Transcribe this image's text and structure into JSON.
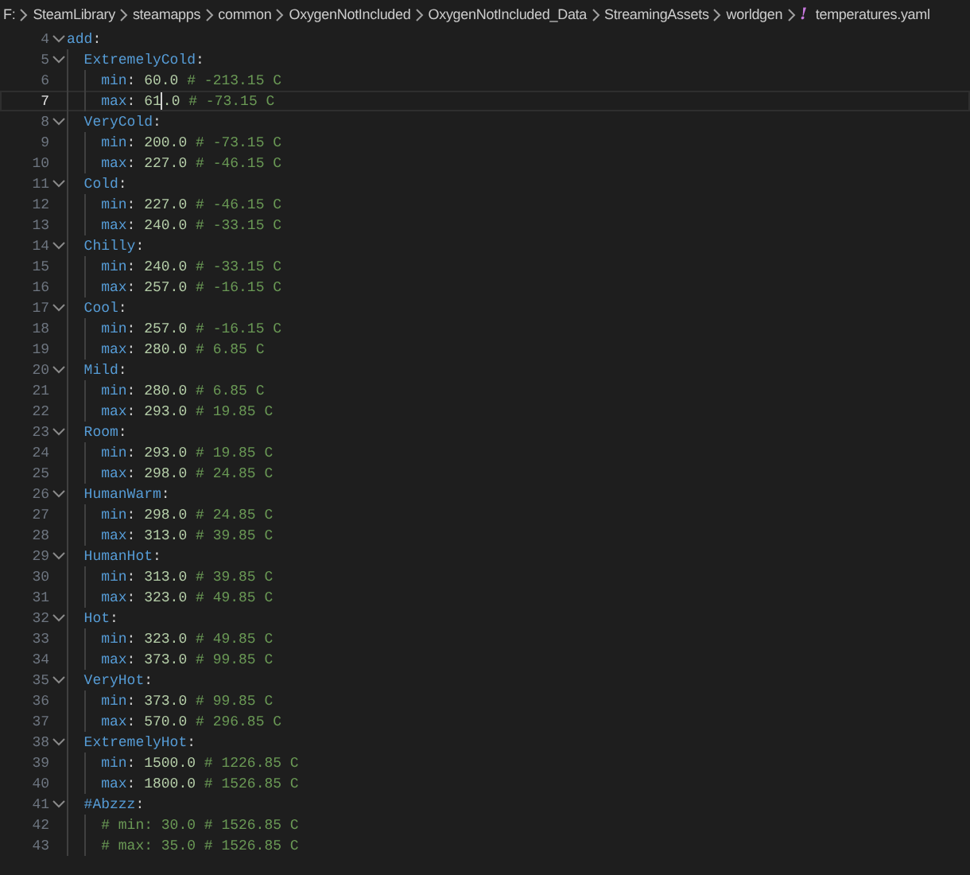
{
  "breadcrumb": [
    {
      "kind": "folder",
      "text": "F:"
    },
    {
      "kind": "folder",
      "text": "SteamLibrary"
    },
    {
      "kind": "folder",
      "text": "steamapps"
    },
    {
      "kind": "folder",
      "text": "common"
    },
    {
      "kind": "folder",
      "text": "OxygenNotIncluded"
    },
    {
      "kind": "folder",
      "text": "OxygenNotIncluded_Data"
    },
    {
      "kind": "folder",
      "text": "StreamingAssets"
    },
    {
      "kind": "folder",
      "text": "worldgen"
    },
    {
      "kind": "yaml",
      "icon": "!",
      "text": "temperatures.yaml"
    }
  ],
  "lines": [
    {
      "number": "4",
      "active": false,
      "tokens": [
        {
          "kind": "key",
          "text": "add"
        },
        {
          "kind": "punct",
          "text": ":"
        }
      ],
      "children": [
        {
          "number": "5",
          "active": false,
          "tokens": [
            {
              "kind": "key",
              "text": "ExtremelyCold"
            },
            {
              "kind": "punct",
              "text": ":"
            }
          ],
          "children": [
            {
              "number": "6",
              "active": false,
              "tokens": [
                {
                  "kind": "key",
                  "text": "min"
                },
                {
                  "kind": "punct",
                  "text": ": "
                },
                {
                  "kind": "number",
                  "text": "60.0"
                },
                {
                  "kind": "comment",
                  "text": " # -213.15 C"
                }
              ]
            },
            {
              "number": "7",
              "active": true,
              "tokens": [
                {
                  "kind": "key",
                  "text": "max"
                },
                {
                  "kind": "punct",
                  "text": ": "
                },
                {
                  "kind": "number",
                  "text": "61"
                },
                {
                  "kind": "caret"
                },
                {
                  "kind": "number",
                  "text": ".0"
                },
                {
                  "kind": "comment",
                  "text": " # -73.15 C"
                }
              ]
            }
          ]
        },
        {
          "number": "8",
          "active": false,
          "tokens": [
            {
              "kind": "key",
              "text": "VeryCold"
            },
            {
              "kind": "punct",
              "text": ":"
            }
          ],
          "children": [
            {
              "number": "9",
              "active": false,
              "tokens": [
                {
                  "kind": "key",
                  "text": "min"
                },
                {
                  "kind": "punct",
                  "text": ": "
                },
                {
                  "kind": "number",
                  "text": "200.0"
                },
                {
                  "kind": "comment",
                  "text": " # -73.15 C"
                }
              ]
            },
            {
              "number": "10",
              "active": false,
              "tokens": [
                {
                  "kind": "key",
                  "text": "max"
                },
                {
                  "kind": "punct",
                  "text": ": "
                },
                {
                  "kind": "number",
                  "text": "227.0"
                },
                {
                  "kind": "comment",
                  "text": " # -46.15 C"
                }
              ]
            }
          ]
        },
        {
          "number": "11",
          "active": false,
          "tokens": [
            {
              "kind": "key",
              "text": "Cold"
            },
            {
              "kind": "punct",
              "text": ":"
            }
          ],
          "children": [
            {
              "number": "12",
              "active": false,
              "tokens": [
                {
                  "kind": "key",
                  "text": "min"
                },
                {
                  "kind": "punct",
                  "text": ": "
                },
                {
                  "kind": "number",
                  "text": "227.0"
                },
                {
                  "kind": "comment",
                  "text": " # -46.15 C"
                }
              ]
            },
            {
              "number": "13",
              "active": false,
              "tokens": [
                {
                  "kind": "key",
                  "text": "max"
                },
                {
                  "kind": "punct",
                  "text": ": "
                },
                {
                  "kind": "number",
                  "text": "240.0"
                },
                {
                  "kind": "comment",
                  "text": " # -33.15 C"
                }
              ]
            }
          ]
        },
        {
          "number": "14",
          "active": false,
          "tokens": [
            {
              "kind": "key",
              "text": "Chilly"
            },
            {
              "kind": "punct",
              "text": ":"
            }
          ],
          "children": [
            {
              "number": "15",
              "active": false,
              "tokens": [
                {
                  "kind": "key",
                  "text": "min"
                },
                {
                  "kind": "punct",
                  "text": ": "
                },
                {
                  "kind": "number",
                  "text": "240.0"
                },
                {
                  "kind": "comment",
                  "text": " # -33.15 C"
                }
              ]
            },
            {
              "number": "16",
              "active": false,
              "tokens": [
                {
                  "kind": "key",
                  "text": "max"
                },
                {
                  "kind": "punct",
                  "text": ": "
                },
                {
                  "kind": "number",
                  "text": "257.0"
                },
                {
                  "kind": "comment",
                  "text": " # -16.15 C"
                }
              ]
            }
          ]
        },
        {
          "number": "17",
          "active": false,
          "tokens": [
            {
              "kind": "key",
              "text": "Cool"
            },
            {
              "kind": "punct",
              "text": ":"
            }
          ],
          "children": [
            {
              "number": "18",
              "active": false,
              "tokens": [
                {
                  "kind": "key",
                  "text": "min"
                },
                {
                  "kind": "punct",
                  "text": ": "
                },
                {
                  "kind": "number",
                  "text": "257.0"
                },
                {
                  "kind": "comment",
                  "text": " # -16.15 C"
                }
              ]
            },
            {
              "number": "19",
              "active": false,
              "tokens": [
                {
                  "kind": "key",
                  "text": "max"
                },
                {
                  "kind": "punct",
                  "text": ": "
                },
                {
                  "kind": "number",
                  "text": "280.0"
                },
                {
                  "kind": "comment",
                  "text": " # 6.85 C"
                }
              ]
            }
          ]
        },
        {
          "number": "20",
          "active": false,
          "tokens": [
            {
              "kind": "key",
              "text": "Mild"
            },
            {
              "kind": "punct",
              "text": ":"
            }
          ],
          "children": [
            {
              "number": "21",
              "active": false,
              "tokens": [
                {
                  "kind": "key",
                  "text": "min"
                },
                {
                  "kind": "punct",
                  "text": ": "
                },
                {
                  "kind": "number",
                  "text": "280.0"
                },
                {
                  "kind": "comment",
                  "text": " # 6.85 C"
                }
              ]
            },
            {
              "number": "22",
              "active": false,
              "tokens": [
                {
                  "kind": "key",
                  "text": "max"
                },
                {
                  "kind": "punct",
                  "text": ": "
                },
                {
                  "kind": "number",
                  "text": "293.0"
                },
                {
                  "kind": "comment",
                  "text": " # 19.85 C"
                }
              ]
            }
          ]
        },
        {
          "number": "23",
          "active": false,
          "tokens": [
            {
              "kind": "key",
              "text": "Room"
            },
            {
              "kind": "punct",
              "text": ":"
            }
          ],
          "children": [
            {
              "number": "24",
              "active": false,
              "tokens": [
                {
                  "kind": "key",
                  "text": "min"
                },
                {
                  "kind": "punct",
                  "text": ": "
                },
                {
                  "kind": "number",
                  "text": "293.0"
                },
                {
                  "kind": "comment",
                  "text": " # 19.85 C"
                }
              ]
            },
            {
              "number": "25",
              "active": false,
              "tokens": [
                {
                  "kind": "key",
                  "text": "max"
                },
                {
                  "kind": "punct",
                  "text": ": "
                },
                {
                  "kind": "number",
                  "text": "298.0"
                },
                {
                  "kind": "comment",
                  "text": " # 24.85 C"
                }
              ]
            }
          ]
        },
        {
          "number": "26",
          "active": false,
          "tokens": [
            {
              "kind": "key",
              "text": "HumanWarm"
            },
            {
              "kind": "punct",
              "text": ":"
            }
          ],
          "children": [
            {
              "number": "27",
              "active": false,
              "tokens": [
                {
                  "kind": "key",
                  "text": "min"
                },
                {
                  "kind": "punct",
                  "text": ": "
                },
                {
                  "kind": "number",
                  "text": "298.0"
                },
                {
                  "kind": "comment",
                  "text": " # 24.85 C"
                }
              ]
            },
            {
              "number": "28",
              "active": false,
              "tokens": [
                {
                  "kind": "key",
                  "text": "max"
                },
                {
                  "kind": "punct",
                  "text": ": "
                },
                {
                  "kind": "number",
                  "text": "313.0"
                },
                {
                  "kind": "comment",
                  "text": " # 39.85 C"
                }
              ]
            }
          ]
        },
        {
          "number": "29",
          "active": false,
          "tokens": [
            {
              "kind": "key",
              "text": "HumanHot"
            },
            {
              "kind": "punct",
              "text": ":"
            }
          ],
          "children": [
            {
              "number": "30",
              "active": false,
              "tokens": [
                {
                  "kind": "key",
                  "text": "min"
                },
                {
                  "kind": "punct",
                  "text": ": "
                },
                {
                  "kind": "number",
                  "text": "313.0"
                },
                {
                  "kind": "comment",
                  "text": " # 39.85 C"
                }
              ]
            },
            {
              "number": "31",
              "active": false,
              "tokens": [
                {
                  "kind": "key",
                  "text": "max"
                },
                {
                  "kind": "punct",
                  "text": ": "
                },
                {
                  "kind": "number",
                  "text": "323.0"
                },
                {
                  "kind": "comment",
                  "text": " # 49.85 C"
                }
              ]
            }
          ]
        },
        {
          "number": "32",
          "active": false,
          "tokens": [
            {
              "kind": "key",
              "text": "Hot"
            },
            {
              "kind": "punct",
              "text": ":"
            }
          ],
          "children": [
            {
              "number": "33",
              "active": false,
              "tokens": [
                {
                  "kind": "key",
                  "text": "min"
                },
                {
                  "kind": "punct",
                  "text": ": "
                },
                {
                  "kind": "number",
                  "text": "323.0"
                },
                {
                  "kind": "comment",
                  "text": " # 49.85 C"
                }
              ]
            },
            {
              "number": "34",
              "active": false,
              "tokens": [
                {
                  "kind": "key",
                  "text": "max"
                },
                {
                  "kind": "punct",
                  "text": ": "
                },
                {
                  "kind": "number",
                  "text": "373.0"
                },
                {
                  "kind": "comment",
                  "text": " # 99.85 C"
                }
              ]
            }
          ]
        },
        {
          "number": "35",
          "active": false,
          "tokens": [
            {
              "kind": "key",
              "text": "VeryHot"
            },
            {
              "kind": "punct",
              "text": ":"
            }
          ],
          "children": [
            {
              "number": "36",
              "active": false,
              "tokens": [
                {
                  "kind": "key",
                  "text": "min"
                },
                {
                  "kind": "punct",
                  "text": ": "
                },
                {
                  "kind": "number",
                  "text": "373.0"
                },
                {
                  "kind": "comment",
                  "text": " # 99.85 C"
                }
              ]
            },
            {
              "number": "37",
              "active": false,
              "tokens": [
                {
                  "kind": "key",
                  "text": "max"
                },
                {
                  "kind": "punct",
                  "text": ": "
                },
                {
                  "kind": "number",
                  "text": "570.0"
                },
                {
                  "kind": "comment",
                  "text": " # 296.85 C"
                }
              ]
            }
          ]
        },
        {
          "number": "38",
          "active": false,
          "tokens": [
            {
              "kind": "key",
              "text": "ExtremelyHot"
            },
            {
              "kind": "punct",
              "text": ":"
            }
          ],
          "children": [
            {
              "number": "39",
              "active": false,
              "tokens": [
                {
                  "kind": "key",
                  "text": "min"
                },
                {
                  "kind": "punct",
                  "text": ": "
                },
                {
                  "kind": "number",
                  "text": "1500.0"
                },
                {
                  "kind": "comment",
                  "text": " # 1226.85 C"
                }
              ]
            },
            {
              "number": "40",
              "active": false,
              "tokens": [
                {
                  "kind": "key",
                  "text": "max"
                },
                {
                  "kind": "punct",
                  "text": ": "
                },
                {
                  "kind": "number",
                  "text": "1800.0"
                },
                {
                  "kind": "comment",
                  "text": " # 1526.85 C"
                }
              ]
            }
          ]
        },
        {
          "number": "41",
          "active": false,
          "tokens": [
            {
              "kind": "key",
              "text": "#Abzzz"
            },
            {
              "kind": "punct",
              "text": ":"
            }
          ],
          "children": [
            {
              "number": "42",
              "active": false,
              "tokens": [
                {
                  "kind": "comment",
                  "text": "# min: 30.0 # 1526.85 C"
                }
              ]
            },
            {
              "number": "43",
              "active": false,
              "tokens": [
                {
                  "kind": "comment",
                  "text": "# max: 35.0 # 1526.85 C"
                }
              ]
            }
          ]
        }
      ]
    }
  ]
}
